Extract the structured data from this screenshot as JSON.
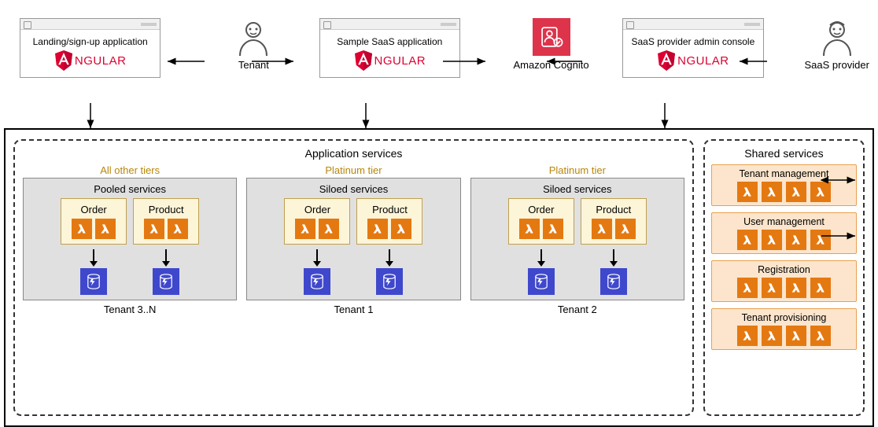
{
  "top": {
    "landing": {
      "title": "Landing/sign-up application",
      "framework": "NGULAR"
    },
    "sample": {
      "title": "Sample SaaS application",
      "framework": "NGULAR"
    },
    "admin": {
      "title": "SaaS provider admin console",
      "framework": "NGULAR"
    },
    "tenant_actor": "Tenant",
    "provider_actor": "SaaS provider",
    "cognito": "Amazon Cognito"
  },
  "app_services": {
    "title": "Application services",
    "tiers": [
      {
        "tier_label": "All other tiers",
        "box_title": "Pooled services",
        "services": [
          "Order",
          "Product"
        ],
        "tenant_label": "Tenant 3..N"
      },
      {
        "tier_label": "Platinum tier",
        "box_title": "Siloed services",
        "services": [
          "Order",
          "Product"
        ],
        "tenant_label": "Tenant 1"
      },
      {
        "tier_label": "Platinum tier",
        "box_title": "Siloed services",
        "services": [
          "Order",
          "Product"
        ],
        "tenant_label": "Tenant 2"
      }
    ]
  },
  "shared_services": {
    "title": "Shared services",
    "items": [
      "Tenant management",
      "User management",
      "Registration",
      "Tenant provisioning"
    ]
  }
}
